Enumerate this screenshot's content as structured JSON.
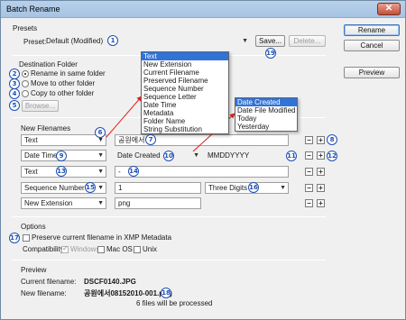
{
  "window": {
    "title": "Batch Rename",
    "close_glyph": "✕"
  },
  "presets": {
    "section": "Presets",
    "label": "Preset:",
    "value": "Default (Modified)",
    "save": "Save...",
    "delete": "Delete..."
  },
  "destination": {
    "section": "Destination Folder",
    "options": [
      "Rename in same folder",
      "Move to other folder",
      "Copy to other folder"
    ],
    "browse": "Browse..."
  },
  "new_filenames": {
    "section": "New Filenames",
    "rows": [
      {
        "type": "Text",
        "value": "공원에서",
        "extra": ""
      },
      {
        "type": "Date Time",
        "value": "Date Created",
        "extra": "MMDDYYYY"
      },
      {
        "type": "Text",
        "value": "-",
        "extra": ""
      },
      {
        "type": "Sequence Number",
        "value": "1",
        "extra": "Three Digits"
      },
      {
        "type": "New Extension",
        "value": "png",
        "extra": ""
      }
    ]
  },
  "type_menu": {
    "items": [
      "Text",
      "New Extension",
      "Current Filename",
      "Preserved Filename",
      "Sequence Number",
      "Sequence Letter",
      "Date Time",
      "Metadata",
      "Folder Name",
      "String Substitution"
    ],
    "selected": "Text"
  },
  "date_menu": {
    "items": [
      "Date Created",
      "Date File Modified",
      "Today",
      "Yesterday"
    ],
    "selected": "Date Created"
  },
  "options": {
    "section": "Options",
    "preserve": "Preserve current filename in XMP Metadata",
    "compat_label": "Compatibility:",
    "windows": "Windows",
    "macos": "Mac OS",
    "unix": "Unix"
  },
  "preview": {
    "section": "Preview",
    "current_label": "Current filename:",
    "current_value": "DSCF0140.JPG",
    "new_label": "New filename:",
    "new_value": "공원에서08152010-001.png",
    "count": "6 files will be processed"
  },
  "actions": {
    "rename": "Rename",
    "cancel": "Cancel",
    "preview": "Preview"
  },
  "badges": [
    "1",
    "2",
    "3",
    "4",
    "5",
    "6",
    "7",
    "8",
    "9",
    "10",
    "11",
    "12",
    "13",
    "14",
    "15",
    "16",
    "17",
    "18",
    "19"
  ],
  "icons": {
    "plus": "+",
    "minus": "−",
    "arrow": "▼"
  },
  "colors": {
    "badge": "#1e4fb4",
    "highlight": "#3173d6",
    "annotation_arrow": "#e0201e"
  }
}
